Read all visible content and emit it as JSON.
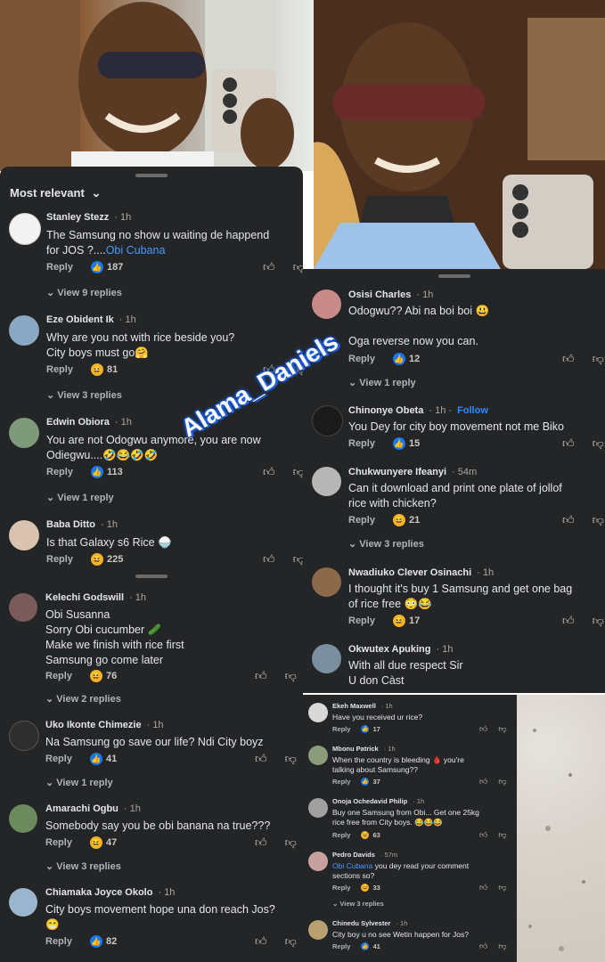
{
  "watermark": "Alama_Daniels",
  "left_panel": {
    "sort_label": "Most relevant",
    "comments": [
      {
        "name": "Stanley Stezz",
        "time": "1h",
        "text_lines": [
          "The Samsung no show u waiting de happend",
          "for JOS ?...."
        ],
        "mention": "Obi Cubana",
        "reply": "Reply",
        "reaction": "like",
        "count": "187",
        "replies": "View 9 replies"
      },
      {
        "name": "Eze Obident Ik",
        "time": "1h",
        "text_lines": [
          "Why are you not with rice beside you?",
          "City boys must go🤗"
        ],
        "reply": "Reply",
        "reaction": "haha",
        "count": "81",
        "replies": "View 3 replies"
      },
      {
        "name": "Edwin Obiora",
        "time": "1h",
        "text_lines": [
          "You are not Odogwu anymore, you are now",
          "Odiegwu....🤣😂🤣🤣"
        ],
        "reply": "Reply",
        "reaction": "like",
        "count": "113",
        "replies": "View 1 reply"
      },
      {
        "name": "Baba Ditto",
        "time": "1h",
        "text_lines": [
          "Is that Galaxy s6 Rice 🍚"
        ],
        "reply": "Reply",
        "reaction": "haha",
        "count": "225",
        "replies": ""
      }
    ]
  },
  "left_panel2": {
    "comments": [
      {
        "name": "Kelechi Godswill",
        "time": "1h",
        "text_lines": [
          "Obi Susanna",
          "Sorry Obi cucumber 🥒",
          "Make we finish with rice first",
          "Samsung go come later"
        ],
        "reply": "Reply",
        "reaction": "haha",
        "count": "76",
        "replies": "View 2 replies"
      },
      {
        "name": "Uko Ikonte Chimezie",
        "time": "1h",
        "text_lines": [
          "Na Samsung go save our life? Ndi City boyz"
        ],
        "reply": "Reply",
        "reaction": "like",
        "count": "41",
        "replies": "View 1 reply"
      },
      {
        "name": "Amarachi Ogbu",
        "time": "1h",
        "text_lines": [
          "Somebody say you be obi banana na true???"
        ],
        "reply": "Reply",
        "reaction": "haha",
        "count": "47",
        "replies": "View 3 replies"
      },
      {
        "name": "Chiamaka Joyce Okolo",
        "time": "1h",
        "text_lines": [
          "City boys movement hope una don reach Jos?",
          "😁"
        ],
        "reply": "Reply",
        "reaction": "like",
        "count": "82",
        "replies": ""
      }
    ]
  },
  "right_panel": {
    "comments": [
      {
        "name": "Osisi Charles",
        "time": "1h",
        "text_lines": [
          "Odogwu?? Abi na boi boi 😃",
          "",
          "Oga reverse now you can."
        ],
        "reply": "Reply",
        "reaction": "like",
        "count": "12",
        "replies": "View 1 reply"
      },
      {
        "name": "Chinonye Obeta",
        "time": "1h",
        "follow": "Follow",
        "text_lines": [
          "You Dey for city boy movement not me Biko"
        ],
        "reply": "Reply",
        "reaction": "like",
        "count": "15",
        "replies": ""
      },
      {
        "name": "Chukwunyere Ifeanyi",
        "time": "54m",
        "text_lines": [
          "Can it download and print one plate of jollof",
          "rice with chicken?"
        ],
        "reply": "Reply",
        "reaction": "haha",
        "count": "21",
        "replies": "View 3 replies"
      },
      {
        "name": "Nwadiuko Clever Osinachi",
        "time": "1h",
        "text_lines": [
          "I thought it's buy 1 Samsung and get one bag",
          "of rice free 😳😂"
        ],
        "reply": "Reply",
        "reaction": "haha",
        "count": "17",
        "replies": ""
      },
      {
        "name": "Okwutex Apuking",
        "time": "1h",
        "text_lines": [
          "With all due respect Sir",
          "U don Càst"
        ],
        "reply": "",
        "reaction": "",
        "count": "",
        "replies": ""
      }
    ]
  },
  "right_panel2": {
    "comments": [
      {
        "name": "Ekeh Maxwell",
        "time": "1h",
        "text_lines": [
          "Have you received ur rice?"
        ],
        "reply": "Reply",
        "reaction": "like",
        "count": "17",
        "replies": ""
      },
      {
        "name": "Mbonu Patrick",
        "time": "1h",
        "text_lines": [
          "When the country is bleeding 🩸 you're",
          "talking about Samsung??"
        ],
        "reply": "Reply",
        "reaction": "like",
        "count": "37",
        "replies": ""
      },
      {
        "name": "Onoja Ochedavid Philip",
        "time": "1h",
        "text_lines": [
          "Buy one Samsung from Obi... Get one 25kg",
          "rice free from City boys. 😂😂😂"
        ],
        "reply": "Reply",
        "reaction": "haha",
        "count": "63",
        "replies": ""
      },
      {
        "name": "Pedro Davids",
        "time": "57m",
        "mention_first": "Obi Cubana",
        "text_lines": [
          " you dey read your comment",
          "sections so?"
        ],
        "reply": "Reply",
        "reaction": "haha",
        "count": "33",
        "replies": "View 3 replies"
      },
      {
        "name": "Chinedu Sylvester",
        "time": "1h",
        "text_lines": [
          "City boy u no see Wetin happen for Jos?"
        ],
        "reply": "Reply",
        "reaction": "like",
        "count": "41",
        "replies": ""
      }
    ]
  }
}
